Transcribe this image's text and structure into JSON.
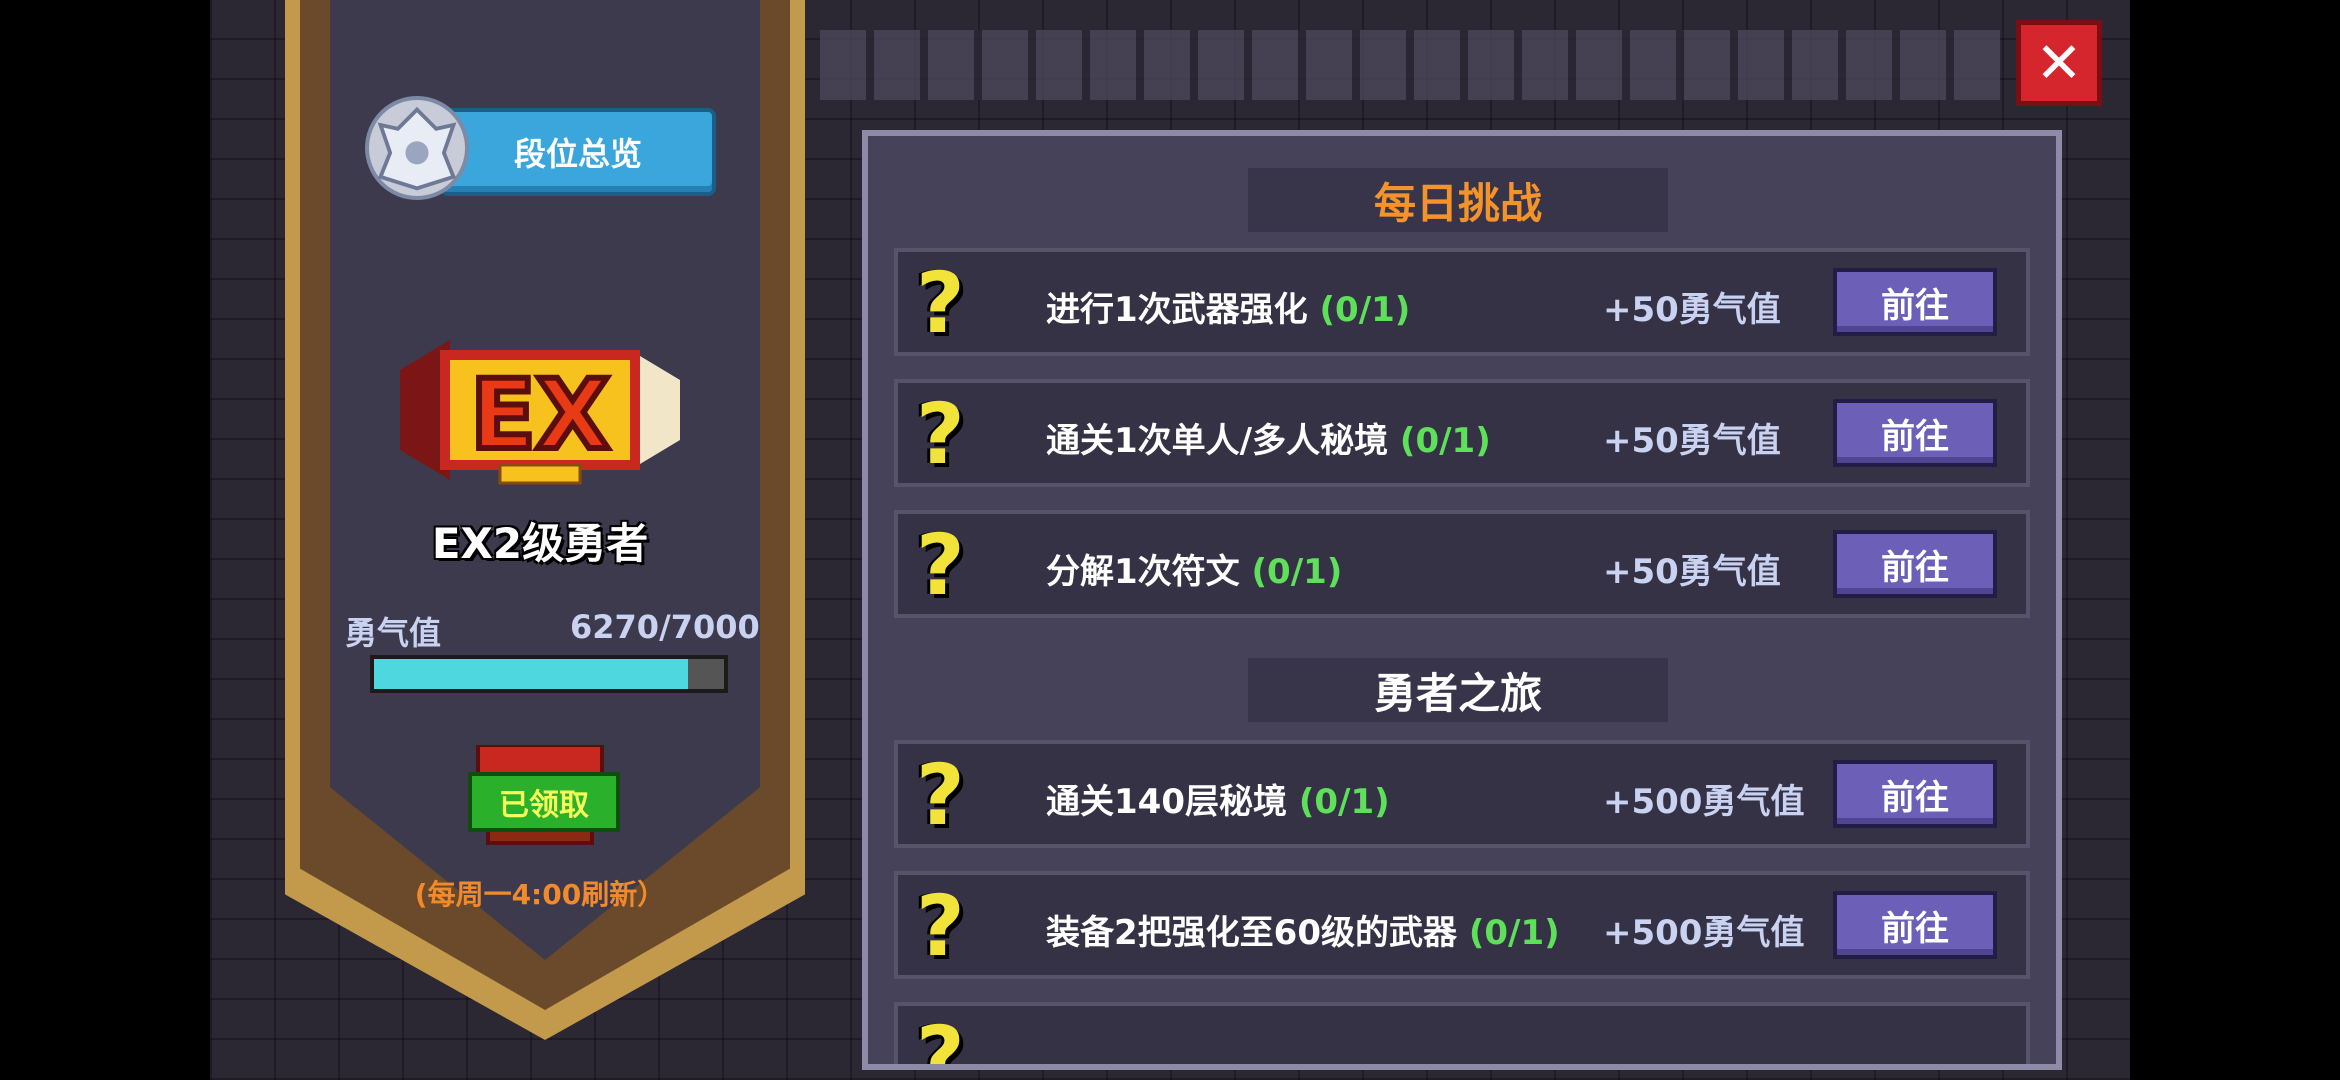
{
  "rank_overview_label": "段位总览",
  "rank": {
    "badge_text": "EX",
    "name": "EX2级勇者"
  },
  "courage": {
    "label": "勇气值",
    "value_text": "6270/7000",
    "progress": 0.896
  },
  "chest": {
    "status_label": "已领取"
  },
  "refresh_note": "(每周一4:00刷新）",
  "sections": [
    {
      "title": "每日挑战",
      "tasks": [
        {
          "desc": "进行1次武器强化",
          "count": "(0/1)",
          "reward": "+50勇气值",
          "button": "前往"
        },
        {
          "desc": "通关1次单人/多人秘境",
          "count": "(0/1)",
          "reward": "+50勇气值",
          "button": "前往"
        },
        {
          "desc": "分解1次符文",
          "count": "(0/1)",
          "reward": "+50勇气值",
          "button": "前往"
        }
      ]
    },
    {
      "title": "勇者之旅",
      "tasks": [
        {
          "desc": "通关140层秘境",
          "count": "(0/1)",
          "reward": "+500勇气值",
          "button": "前往"
        },
        {
          "desc": "装备2把强化至60级的武器",
          "count": "(0/1)",
          "reward": "+500勇气值",
          "button": "前往"
        }
      ]
    }
  ],
  "colors": {
    "accent_orange": "#f5932b",
    "progress_cyan": "#4fd7e0",
    "close_red": "#d6262d",
    "count_green": "#5ee05a"
  }
}
